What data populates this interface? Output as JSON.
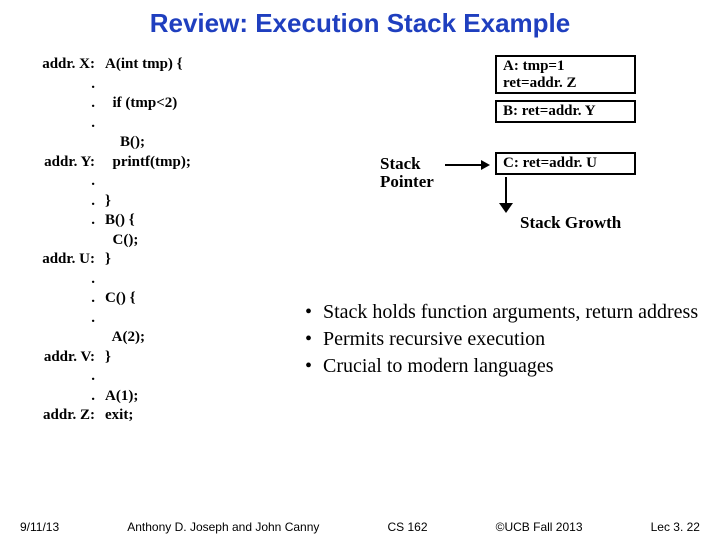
{
  "title": "Review: Execution Stack Example",
  "code": [
    {
      "addr": "addr. X:",
      "txt": "A(int tmp) {"
    },
    {
      "addr": ".",
      "txt": ""
    },
    {
      "addr": ".",
      "txt": "  if (tmp<2)"
    },
    {
      "addr": ".",
      "txt": ""
    },
    {
      "addr": "",
      "txt": "    B();"
    },
    {
      "addr": "addr. Y:",
      "txt": "  printf(tmp);"
    },
    {
      "addr": ".",
      "txt": ""
    },
    {
      "addr": ".",
      "txt": "}"
    },
    {
      "addr": ".",
      "txt": "B() {"
    },
    {
      "addr": "",
      "txt": ""
    },
    {
      "addr": "",
      "txt": "  C();"
    },
    {
      "addr": "addr. U:",
      "txt": "}"
    },
    {
      "addr": ".",
      "txt": ""
    },
    {
      "addr": ".",
      "txt": "C() {"
    },
    {
      "addr": ".",
      "txt": ""
    },
    {
      "addr": "",
      "txt": "  A(2);"
    },
    {
      "addr": "addr. V:",
      "txt": "}"
    },
    {
      "addr": ".",
      "txt": ""
    },
    {
      "addr": ".",
      "txt": "A(1);"
    },
    {
      "addr": "addr. Z:",
      "txt": "exit;"
    }
  ],
  "frames": {
    "a_line1": "A: tmp=1",
    "a_line2": "    ret=addr. Z",
    "b": "B: ret=addr. Y",
    "c": "C: ret=addr. U"
  },
  "labels": {
    "stack_pointer": "Stack\nPointer",
    "stack_growth": "Stack Growth"
  },
  "bullets": [
    "Stack holds function arguments, return address",
    "Permits recursive execution",
    "Crucial to modern languages"
  ],
  "footer": {
    "date": "9/11/13",
    "authors": "Anthony D. Joseph and John Canny",
    "course": "CS 162",
    "copyright": "©UCB Fall 2013",
    "lec": "Lec 3. 22"
  }
}
